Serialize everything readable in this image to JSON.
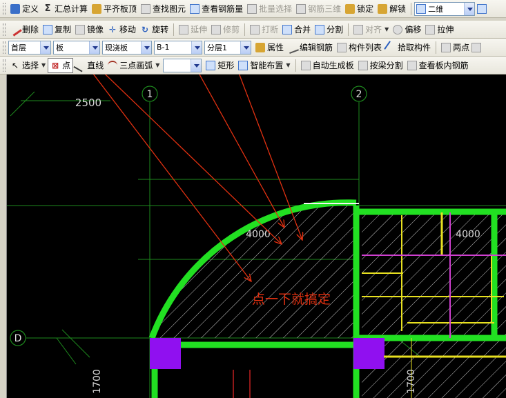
{
  "toolbar1": {
    "items": [
      {
        "label": "定义"
      },
      {
        "label": "汇总计算"
      },
      {
        "label": "平齐板顶"
      },
      {
        "label": "查找图元"
      },
      {
        "label": "查看钢筋量"
      },
      {
        "label": "批量选择"
      },
      {
        "label": "钢筋三维"
      },
      {
        "label": "锁定"
      },
      {
        "label": "解锁"
      }
    ],
    "view_mode": "二维"
  },
  "toolbar2": {
    "items": [
      {
        "label": "删除"
      },
      {
        "label": "复制"
      },
      {
        "label": "镜像"
      },
      {
        "label": "移动"
      },
      {
        "label": "旋转"
      },
      {
        "label": "延伸"
      },
      {
        "label": "修剪"
      },
      {
        "label": "打断"
      },
      {
        "label": "合并"
      },
      {
        "label": "分割"
      },
      {
        "label": "对齐"
      },
      {
        "label": "偏移"
      },
      {
        "label": "拉伸"
      }
    ]
  },
  "toolbar3": {
    "floor": "首层",
    "component_type": "板",
    "sub_type": "现浇板",
    "component_name": "B-1",
    "layer": "分层1",
    "items": [
      {
        "label": "属性"
      },
      {
        "label": "编辑钢筋"
      },
      {
        "label": "构件列表"
      },
      {
        "label": "拾取构件"
      },
      {
        "label": "两点"
      }
    ]
  },
  "toolbar4": {
    "items": [
      {
        "label": "选择"
      },
      {
        "label": "点"
      },
      {
        "label": "直线"
      },
      {
        "label": "三点画弧"
      },
      {
        "label": "矩形"
      },
      {
        "label": "智能布置"
      },
      {
        "label": "自动生成板"
      },
      {
        "label": "按梁分割"
      },
      {
        "label": "查看板内钢筋"
      }
    ],
    "arc_option": ""
  },
  "drawing": {
    "axis_1": "1",
    "axis_2": "2",
    "axis_d": "D",
    "dim_top": "2500",
    "dim_slab_left": "4000",
    "dim_slab_right": "4000",
    "dim_bottom_left": "1700",
    "dim_bottom_right": "1700",
    "annotation": "点一下就搞定"
  },
  "colors": {
    "beam": "#22e022",
    "slab_hatch": "#c8c8c8",
    "axis_line": "#1e8a1e",
    "column": "#9010f0",
    "rebar_yellow": "#e8e020",
    "rebar_magenta": "#d040d0",
    "arrow": "#e03010",
    "annotation_text": "#e03010"
  }
}
